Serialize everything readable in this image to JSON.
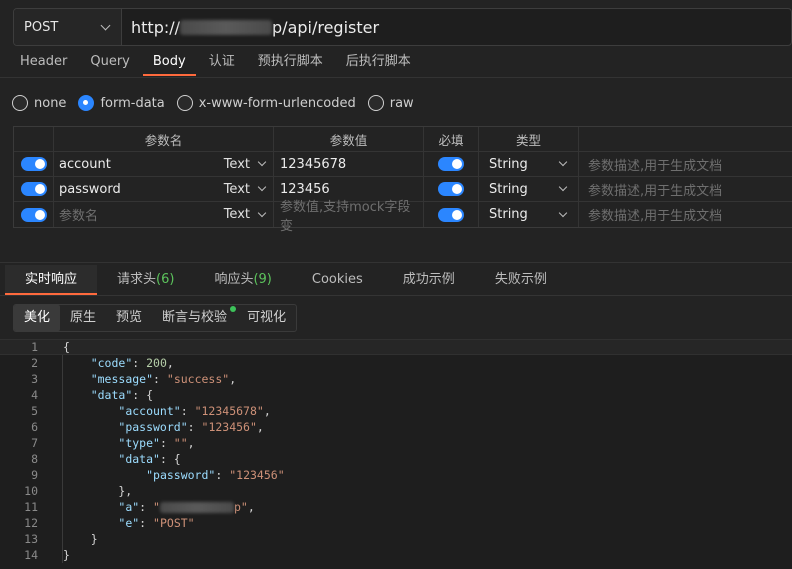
{
  "request": {
    "method": "POST",
    "url_prefix": "http://",
    "url_suffix": "p/api/register"
  },
  "request_tabs": [
    {
      "label": "Header",
      "active": false
    },
    {
      "label": "Query",
      "active": false
    },
    {
      "label": "Body",
      "active": true
    },
    {
      "label": "认证",
      "active": false
    },
    {
      "label": "预执行脚本",
      "active": false
    },
    {
      "label": "后执行脚本",
      "active": false
    }
  ],
  "body_types": [
    {
      "label": "none",
      "checked": false
    },
    {
      "label": "form-data",
      "checked": true
    },
    {
      "label": "x-www-form-urlencoded",
      "checked": false
    },
    {
      "label": "raw",
      "checked": false
    }
  ],
  "params_table": {
    "headers": {
      "name": "参数名",
      "value": "参数值",
      "required": "必填",
      "type": "类型"
    },
    "rows": [
      {
        "enabled": true,
        "name": "account",
        "field_type": "Text",
        "value": "12345678",
        "required": true,
        "type": "String",
        "desc_placeholder": "参数描述,用于生成文档"
      },
      {
        "enabled": true,
        "name": "password",
        "field_type": "Text",
        "value": "123456",
        "required": true,
        "type": "String",
        "desc_placeholder": "参数描述,用于生成文档"
      }
    ],
    "empty_row": {
      "enabled": true,
      "name_placeholder": "参数名",
      "field_type": "Text",
      "value_placeholder": "参数值,支持mock字段变",
      "required": true,
      "type": "String",
      "desc_placeholder": "参数描述,用于生成文档"
    }
  },
  "response_tabs": [
    {
      "label": "实时响应",
      "active": true
    },
    {
      "label": "请求头",
      "count": "(6)",
      "active": false
    },
    {
      "label": "响应头",
      "count": "(9)",
      "active": false
    },
    {
      "label": "Cookies",
      "active": false
    },
    {
      "label": "成功示例",
      "active": false
    },
    {
      "label": "失败示例",
      "active": false
    }
  ],
  "view_modes": [
    {
      "label": "美化",
      "active": true
    },
    {
      "label": "原生",
      "active": false
    },
    {
      "label": "预览",
      "active": false
    },
    {
      "label": "断言与校验",
      "active": false,
      "dot": true
    },
    {
      "label": "可视化",
      "active": false
    }
  ],
  "response_body": {
    "line_numbers": [
      "1",
      "2",
      "3",
      "4",
      "5",
      "6",
      "7",
      "8",
      "9",
      "10",
      "11",
      "12",
      "13",
      "14"
    ],
    "code": 200,
    "message": "success",
    "data": {
      "account": "12345678",
      "password": "123456",
      "type": "",
      "inner_password": "123456",
      "a_suffix": "p",
      "e": "POST"
    }
  },
  "colors": {
    "accent": "#ff6a3d",
    "toggle_on": "#2b86ff",
    "count_green": "#5cc35c",
    "json_key": "#9cdcfe",
    "json_string": "#ce9178",
    "json_number": "#b5cea8"
  }
}
